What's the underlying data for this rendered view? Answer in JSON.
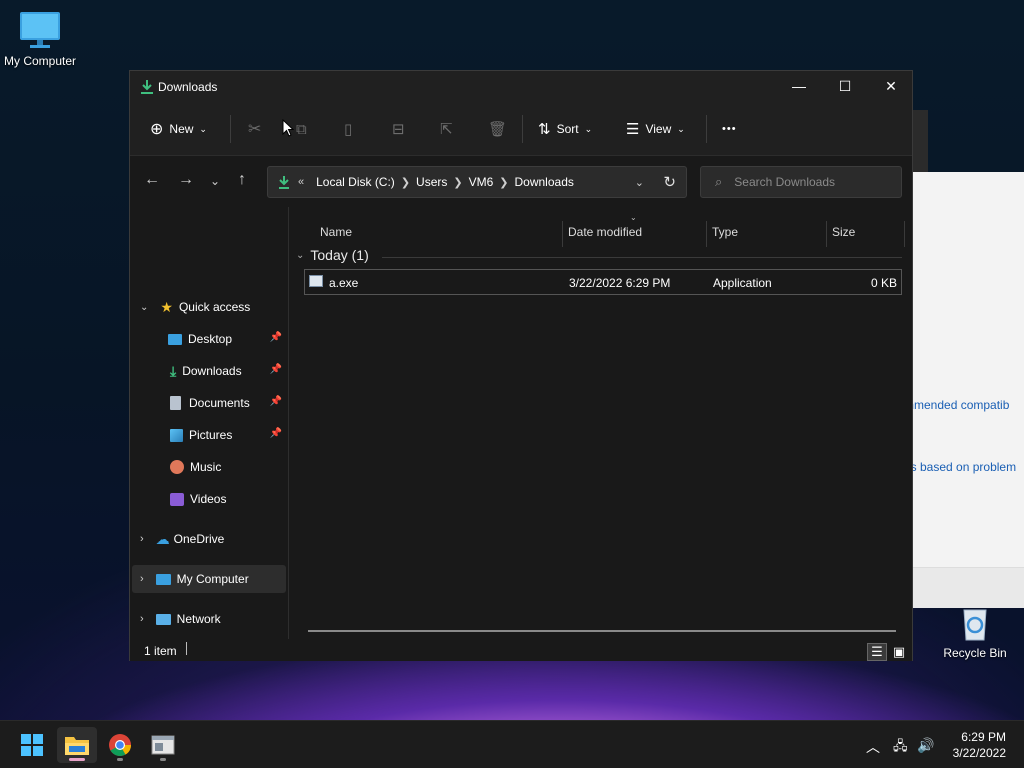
{
  "desktop": {
    "icons": [
      {
        "label": "My Computer"
      },
      {
        "label": "Recycle Bin"
      }
    ],
    "background_window": {
      "link1": "mmended compatib",
      "link2": "gs based on problem"
    }
  },
  "window": {
    "title": "Downloads",
    "controls": {
      "minimize": "—",
      "maximize": "☐",
      "close": "✕"
    },
    "toolbar": {
      "new_label": "New",
      "sort_label": "Sort",
      "view_label": "View",
      "more_label": "•••"
    },
    "address": {
      "overflow": "«",
      "crumbs": [
        "Local Disk (C:)",
        "Users",
        "VM6",
        "Downloads"
      ],
      "search_placeholder": "Search Downloads"
    },
    "nav": {
      "quick_access": "Quick access",
      "items": [
        {
          "label": "Desktop",
          "icon": "desktop-icon",
          "pinned": true
        },
        {
          "label": "Downloads",
          "icon": "downloads-icon",
          "pinned": true
        },
        {
          "label": "Documents",
          "icon": "documents-icon",
          "pinned": true
        },
        {
          "label": "Pictures",
          "icon": "pictures-icon",
          "pinned": true
        },
        {
          "label": "Music",
          "icon": "music-icon",
          "pinned": false
        },
        {
          "label": "Videos",
          "icon": "videos-icon",
          "pinned": false
        }
      ],
      "onedrive": "OneDrive",
      "my_computer": "My Computer",
      "network": "Network"
    },
    "columns": [
      "Name",
      "Date modified",
      "Type",
      "Size"
    ],
    "group_label": "Today (1)",
    "files": [
      {
        "name": "a.exe",
        "date": "3/22/2022 6:29 PM",
        "type": "Application",
        "size": "0 KB"
      }
    ],
    "status": "1 item"
  },
  "taskbar": {
    "time": "6:29 PM",
    "date": "3/22/2022",
    "accent": "#e8a3c8"
  }
}
